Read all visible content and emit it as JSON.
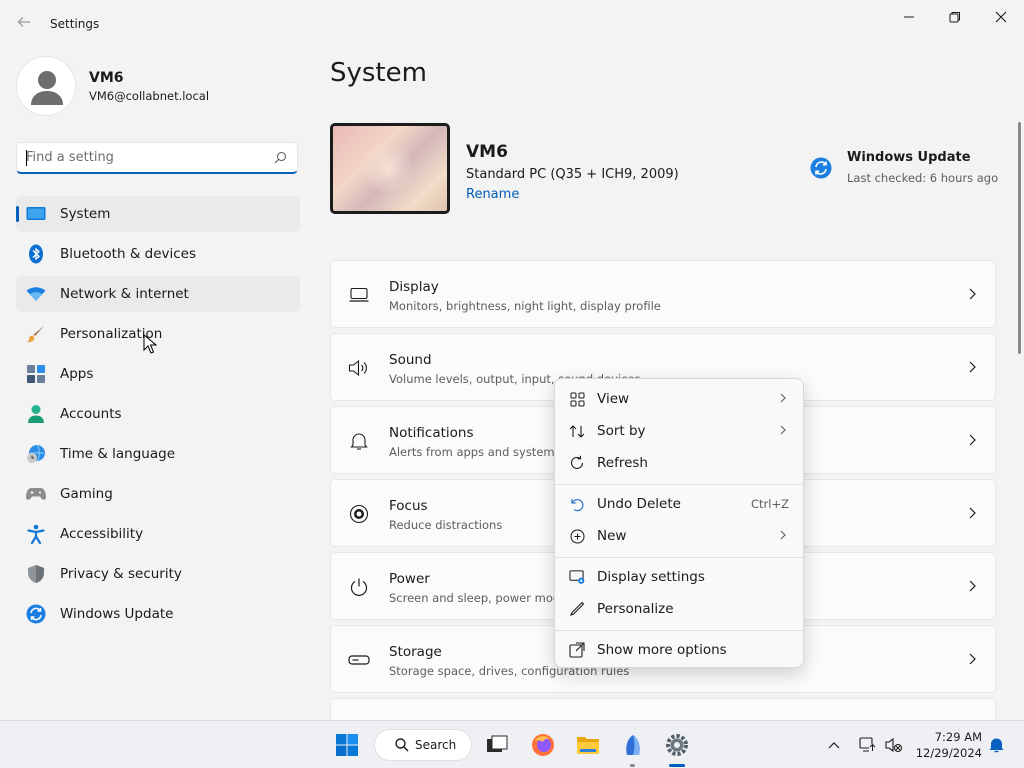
{
  "window": {
    "title": "Settings",
    "controls": [
      "minimize-icon",
      "restore-icon",
      "close-icon"
    ]
  },
  "profile": {
    "name": "VM6",
    "email": "VM6@collabnet.local"
  },
  "search": {
    "placeholder": "Find a setting"
  },
  "nav": {
    "items": [
      {
        "label": "System",
        "icon": "monitor-icon"
      },
      {
        "label": "Bluetooth & devices",
        "icon": "bluetooth-icon"
      },
      {
        "label": "Network & internet",
        "icon": "wifi-icon"
      },
      {
        "label": "Personalization",
        "icon": "brush-icon"
      },
      {
        "label": "Apps",
        "icon": "apps-icon"
      },
      {
        "label": "Accounts",
        "icon": "person-icon"
      },
      {
        "label": "Time & language",
        "icon": "globe-clock-icon"
      },
      {
        "label": "Gaming",
        "icon": "gamepad-icon"
      },
      {
        "label": "Accessibility",
        "icon": "accessibility-icon"
      },
      {
        "label": "Privacy & security",
        "icon": "shield-icon"
      },
      {
        "label": "Windows Update",
        "icon": "update-icon"
      }
    ]
  },
  "main": {
    "title": "System",
    "device": {
      "name": "VM6",
      "model": "Standard PC (Q35 + ICH9, 2009)",
      "rename": "Rename"
    },
    "windows_update": {
      "title": "Windows Update",
      "status": "Last checked: 6 hours ago"
    },
    "cards": [
      {
        "title": "Display",
        "desc": "Monitors, brightness, night light, display profile",
        "icon": "display-icon"
      },
      {
        "title": "Sound",
        "desc": "Volume levels, output, input, sound devices",
        "icon": "speaker-icon"
      },
      {
        "title": "Notifications",
        "desc": "Alerts from apps and system, d",
        "icon": "bell-icon"
      },
      {
        "title": "Focus",
        "desc": "Reduce distractions",
        "icon": "focus-icon"
      },
      {
        "title": "Power",
        "desc": "Screen and sleep, power mode",
        "icon": "power-icon"
      },
      {
        "title": "Storage",
        "desc": "Storage space, drives, configuration rules",
        "icon": "drive-icon"
      }
    ]
  },
  "context_menu": {
    "items": [
      {
        "label": "View",
        "icon": "grid-icon",
        "submenu": true
      },
      {
        "label": "Sort by",
        "icon": "sort-icon",
        "submenu": true
      },
      {
        "label": "Refresh",
        "icon": "refresh-icon"
      },
      {
        "label": "Undo Delete",
        "icon": "undo-icon",
        "shortcut": "Ctrl+Z"
      },
      {
        "label": "New",
        "icon": "plus-circle-icon",
        "submenu": true
      },
      {
        "label": "Display settings",
        "icon": "display-settings-icon"
      },
      {
        "label": "Personalize",
        "icon": "pen-icon"
      },
      {
        "label": "Show more options",
        "icon": "open-external-icon"
      }
    ]
  },
  "taskbar": {
    "search_label": "Search",
    "time": "7:29 AM",
    "date": "12/29/2024"
  },
  "colors": {
    "accent": "#005fb8",
    "background": "#f3f3f3",
    "card": "#fbfbfb"
  }
}
